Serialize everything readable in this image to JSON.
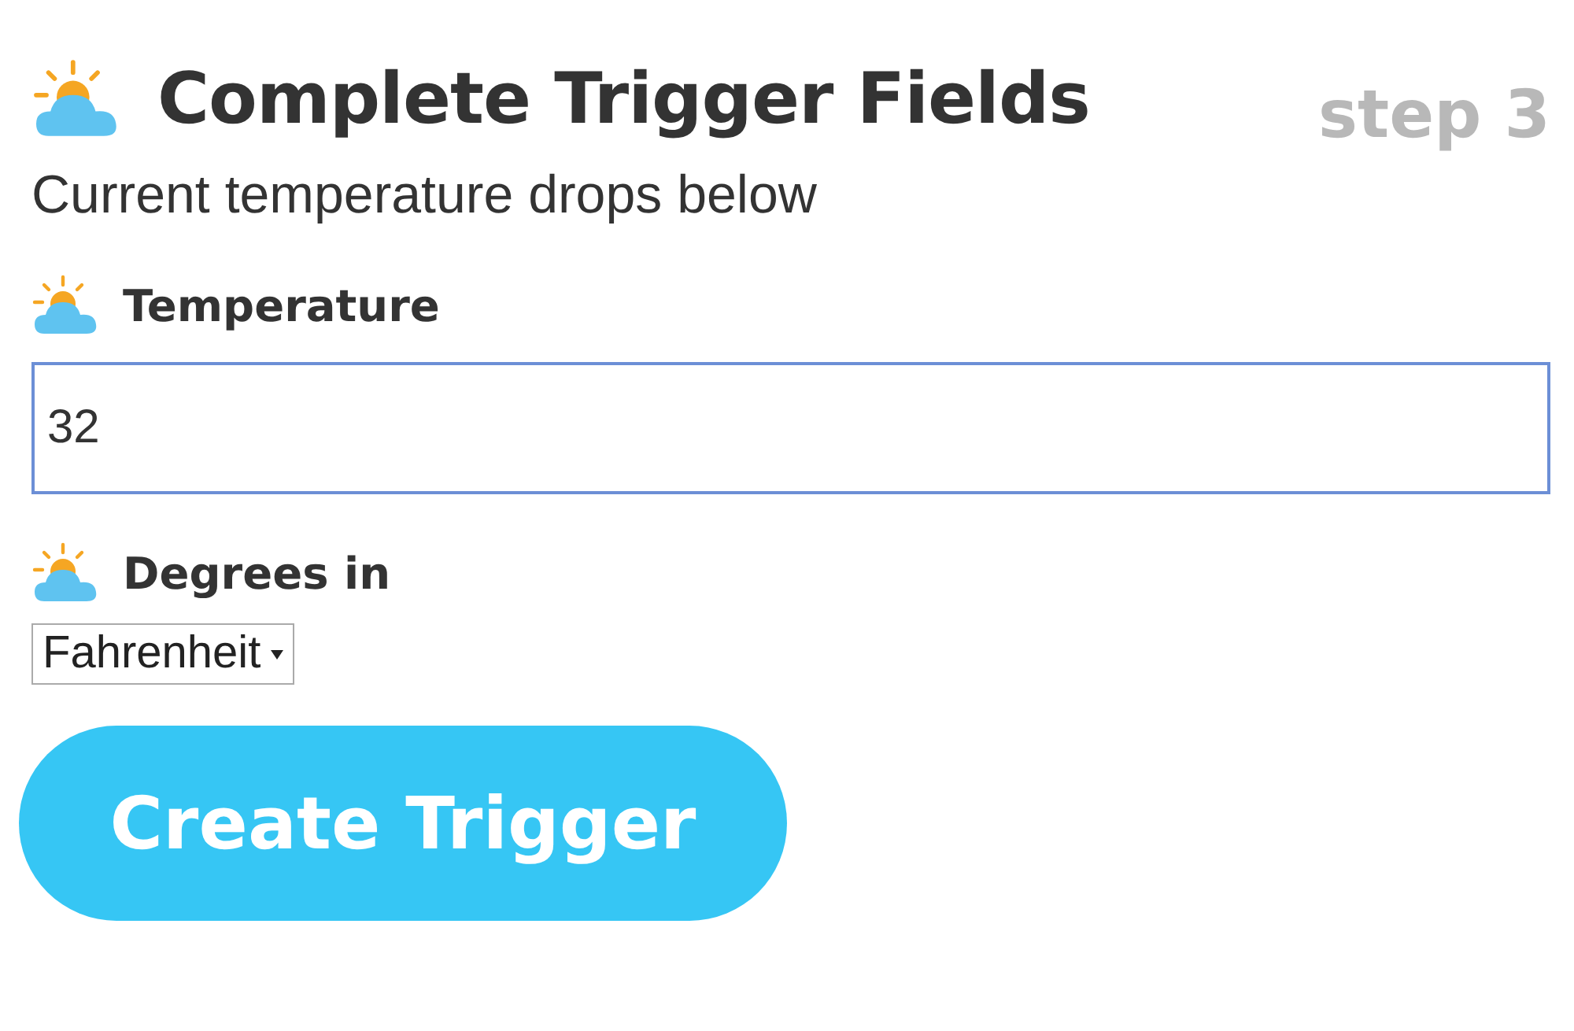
{
  "header": {
    "title": "Complete Trigger Fields",
    "step": "step 3"
  },
  "subtitle": "Current temperature drops below",
  "fields": [
    {
      "kind": "text",
      "label": "Temperature",
      "value": "32"
    },
    {
      "kind": "select",
      "label": "Degrees in",
      "value": "Fahrenheit"
    }
  ],
  "submit_button": "Create Trigger"
}
